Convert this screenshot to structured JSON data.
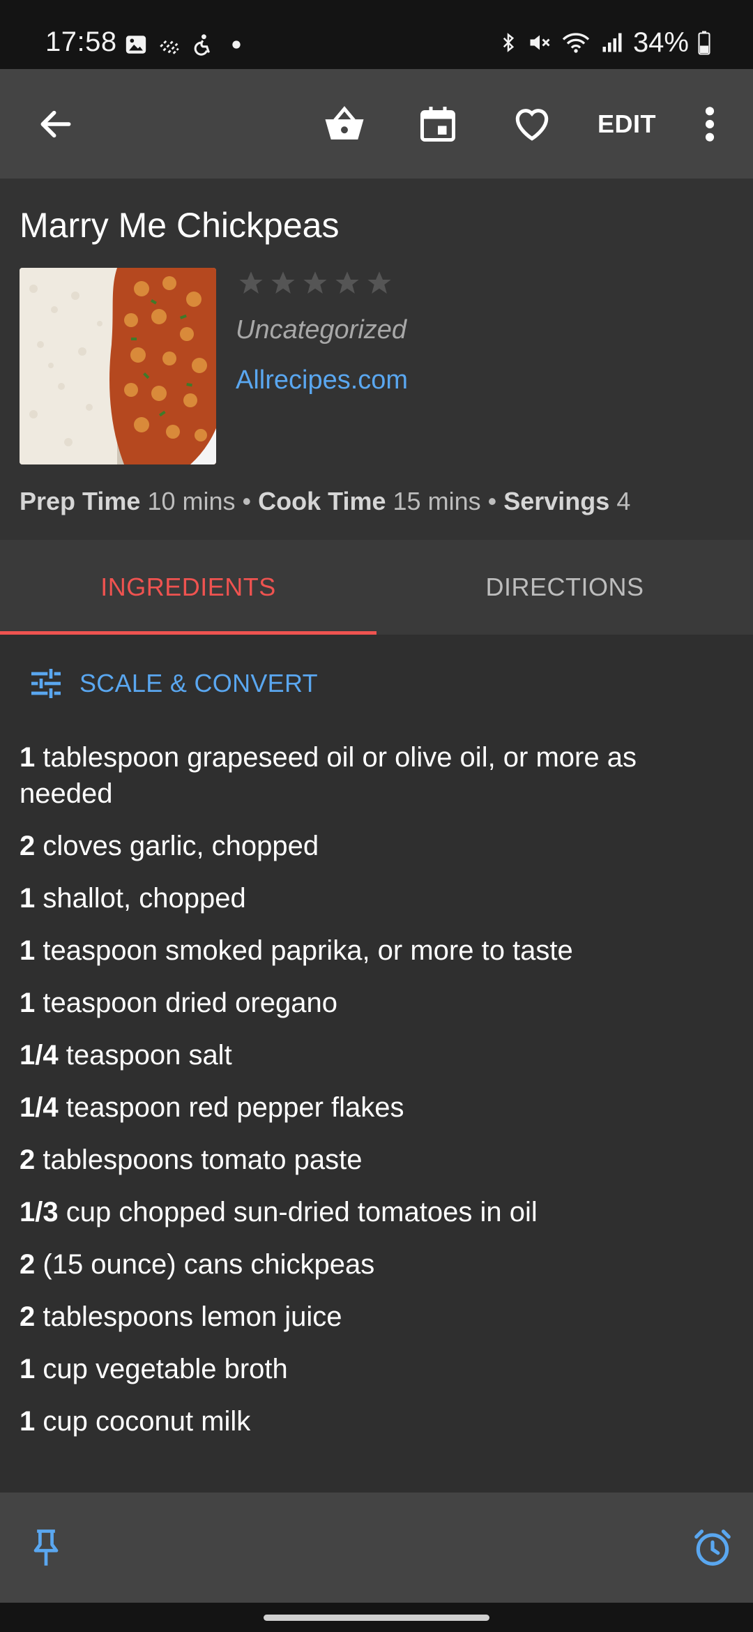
{
  "status_bar": {
    "time": "17:58",
    "battery_percent": "34%",
    "left_icons": [
      "gallery-icon",
      "signal-waves-icon",
      "accessibility-icon",
      "dot-icon"
    ],
    "right_icons": [
      "bluetooth-icon",
      "mute-icon",
      "wifi-icon",
      "cell-signal-icon",
      "battery-icon"
    ]
  },
  "app_bar": {
    "back_icon": "arrow-back-icon",
    "basket_icon": "shopping-basket-icon",
    "calendar_icon": "calendar-icon",
    "favorite_icon": "heart-outline-icon",
    "edit_label": "EDIT",
    "more_icon": "more-vertical-icon"
  },
  "recipe": {
    "title": "Marry Me Chickpeas",
    "rating": 0,
    "rating_max": 5,
    "category": "Uncategorized",
    "source": "Allrecipes.com",
    "prep_time_label": "Prep Time",
    "prep_time_value": "10 mins",
    "cook_time_label": "Cook Time",
    "cook_time_value": "15 mins",
    "servings_label": "Servings",
    "servings_value": "4",
    "separator": "•"
  },
  "tabs": [
    {
      "label": "INGREDIENTS",
      "active": true
    },
    {
      "label": "DIRECTIONS",
      "active": false
    }
  ],
  "scale_convert_label": "SCALE & CONVERT",
  "ingredients": [
    {
      "qty": "1",
      "text": "tablespoon grapeseed oil or olive oil, or more as needed"
    },
    {
      "qty": "2",
      "text": "cloves garlic, chopped"
    },
    {
      "qty": "1",
      "text": "shallot, chopped"
    },
    {
      "qty": "1",
      "text": "teaspoon smoked paprika, or more to taste"
    },
    {
      "qty": "1",
      "text": "teaspoon dried oregano"
    },
    {
      "qty": "1/4",
      "text": "teaspoon salt"
    },
    {
      "qty": "1/4",
      "text": "teaspoon red pepper flakes"
    },
    {
      "qty": "2",
      "text": "tablespoons tomato paste"
    },
    {
      "qty": "1/3",
      "text": "cup chopped sun-dried tomatoes in oil"
    },
    {
      "qty": "2",
      "text": "(15 ounce) cans chickpeas"
    },
    {
      "qty": "2",
      "text": "tablespoons lemon juice"
    },
    {
      "qty": "1",
      "text": "cup vegetable broth"
    },
    {
      "qty": "1",
      "text": "cup coconut milk"
    }
  ],
  "bottom_bar": {
    "pin_icon": "pin-icon",
    "timer_icon": "alarm-clock-icon"
  },
  "colors": {
    "accent_red": "#ef5350",
    "link_blue": "#5aa7f0",
    "appbar_bg": "#444444",
    "content_bg": "#2f2f2f"
  }
}
